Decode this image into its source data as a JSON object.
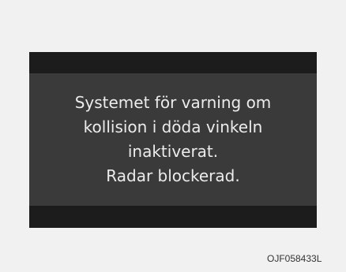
{
  "display": {
    "message_lines": [
      "Systemet för varning om",
      "kollision i döda vinkeln",
      "inaktiverat.",
      "Radar blockerad."
    ]
  },
  "figure_code": "OJF058433L",
  "colors": {
    "page_background": "#f1f1f1",
    "screen_body": "#3a3a3a",
    "screen_band": "#1c1c1c",
    "message_text": "#ececec"
  }
}
